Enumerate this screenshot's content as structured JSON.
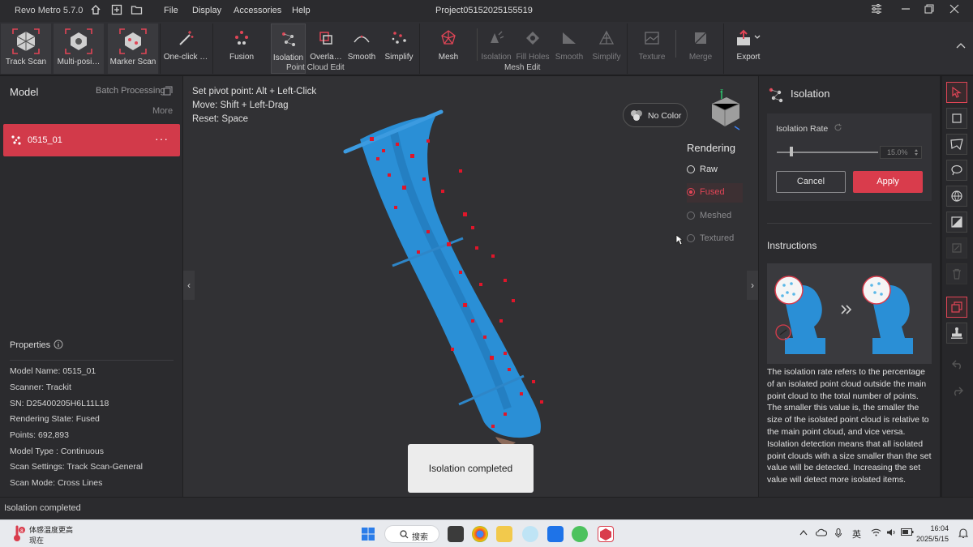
{
  "app": {
    "title": "Revo Metro 5.7.0",
    "project": "Project05152025155519"
  },
  "menu": [
    "File",
    "Display",
    "Accessories",
    "Help"
  ],
  "toolbar": {
    "scan_tools": [
      "Track Scan",
      "Multi-posi…",
      "Marker Scan"
    ],
    "one_click": "One-click …",
    "point_cloud_tools": [
      "Fusion",
      "Isolation",
      "Overla…",
      "Smooth",
      "Simplify"
    ],
    "point_cloud_group": "Point Cloud Edit",
    "mesh_tools": [
      "Mesh",
      "Isolation",
      "Fill Holes",
      "Smooth",
      "Simplify"
    ],
    "mesh_group": "Mesh Edit",
    "texture": "Texture",
    "merge": "Merge",
    "export": "Export"
  },
  "left_panel": {
    "title": "Model",
    "batch": "Batch Processing",
    "more": "More",
    "model_item": "0515_01",
    "model_menu": "···",
    "properties_title": "Properties",
    "properties": [
      "Model Name:  0515_01",
      "Scanner:  Trackit",
      "SN:  D25400205H6L11L18",
      "Rendering State:  Fused",
      "Points:  692,893",
      "Model Type :  Continuous",
      "Scan Settings:  Track Scan-General",
      "Scan Mode:  Cross Lines"
    ]
  },
  "viewport": {
    "hints": [
      "Set pivot point:  Alt + Left-Click",
      "Move:  Shift + Left-Drag",
      "Reset:  Space"
    ],
    "no_color": "No Color",
    "rendering_title": "Rendering",
    "rendering_options": [
      "Raw",
      "Fused",
      "Meshed",
      "Textured"
    ],
    "toast": "Isolation completed"
  },
  "right_panel": {
    "title": "Isolation",
    "rate_label": "Isolation Rate",
    "rate_value": "15.0%",
    "rate_level": 0.15,
    "cancel": "Cancel",
    "apply": "Apply",
    "instructions_title": "Instructions",
    "instructions_text": "The isolation rate refers to the percentage of an isolated point cloud outside the main point cloud to the total number of points. The smaller this value is, the smaller the size of the isolated point cloud is relative to the main point cloud, and vice versa. Isolation detection means that all isolated point clouds with a size smaller than the set value will be detected. Increasing the set value will detect more isolated items."
  },
  "status": {
    "text": "Isolation completed"
  },
  "taskbar": {
    "weather_line1": "体感温度更高",
    "weather_line2": "现在",
    "search": "搜索",
    "ime": "英",
    "time": "16:04",
    "date": "2025/5/15"
  },
  "colors": {
    "accent": "#d93c4c",
    "model_blue": "#2a8fd6",
    "outlier_red": "#e0162a"
  }
}
